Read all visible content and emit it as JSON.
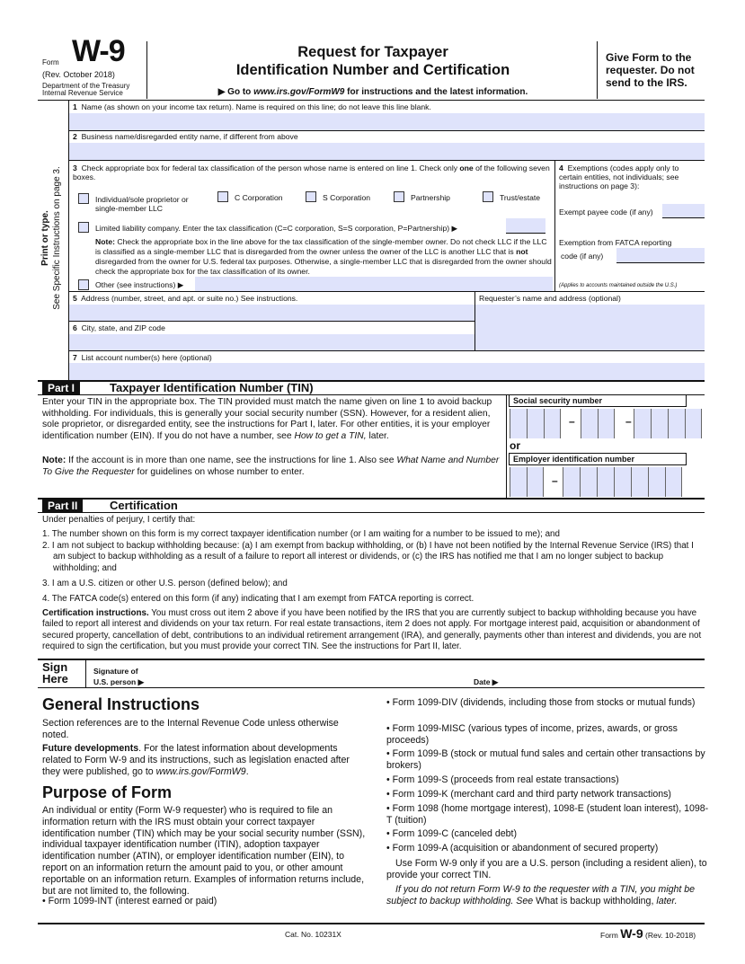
{
  "header": {
    "form_label": "Form",
    "form_number": "W-9",
    "revision": "(Rev. October 2018)",
    "department": "Department of the Treasury",
    "agency": "Internal Revenue Service",
    "title_line1": "Request for Taxpayer",
    "title_line2": "Identification Number and Certification",
    "goto_prefix": "▶ Go to ",
    "goto_url": "www.irs.gov/FormW9",
    "goto_suffix": " for instructions and the latest information.",
    "give_form": "Give Form to the requester. Do not send to the IRS."
  },
  "sidebar": {
    "line1": "Print or type.",
    "line2": "See Specific Instructions on page 3."
  },
  "fields": {
    "line1_num": "1",
    "line1_label": "Name (as shown on your income tax return). Name is required on this line; do not leave this line blank.",
    "line1_value": "",
    "line2_num": "2",
    "line2_label": "Business name/disregarded entity name, if different from above",
    "line2_value": "",
    "line3_num": "3",
    "line3_label_a": "Check appropriate box for federal tax classification of the person whose name is entered on line 1. Check only ",
    "line3_label_bold": "one",
    "line3_label_b": " of the following seven boxes.",
    "classifications": [
      {
        "label": "Individual/sole proprietor or single-member LLC",
        "checked": false
      },
      {
        "label": "C Corporation",
        "checked": false
      },
      {
        "label": "S Corporation",
        "checked": false
      },
      {
        "label": "Partnership",
        "checked": false
      },
      {
        "label": "Trust/estate",
        "checked": false
      }
    ],
    "llc_label": "Limited liability company. Enter the tax classification (C=C corporation, S=S corporation, P=Partnership) ▶",
    "llc_checked": false,
    "llc_value": "",
    "note_bold": "Note:",
    "note_a": " Check the appropriate box in the line above for the tax classification of the single-member owner.  Do not check LLC if the LLC is classified as a single-member LLC that is disregarded from the owner unless the owner of the LLC is another LLC that is ",
    "note_bold2": "not",
    "note_b": " disregarded from the owner for U.S. federal tax purposes. Otherwise, a single-member LLC that is disregarded from the owner should check the appropriate box for the tax classification of its owner.",
    "other_label": "Other (see instructions) ▶",
    "other_checked": false,
    "other_value": "",
    "line4_num": "4",
    "line4_label": "Exemptions (codes apply only to certain entities, not individuals; see instructions on page 3):",
    "exempt_payee_label": "Exempt payee code (if any)",
    "exempt_payee_value": "",
    "fatca_label_1": "Exemption from FATCA reporting",
    "fatca_label_2": "code (if any)",
    "fatca_value": "",
    "fatca_note": "(Applies to accounts maintained outside the U.S.)",
    "line5_num": "5",
    "line5_label": "Address (number, street, and apt. or suite no.) See instructions.",
    "line5_value": "",
    "requester_label": "Requester’s name and address (optional)",
    "requester_value": "",
    "line6_num": "6",
    "line6_label": "City, state, and ZIP code",
    "line6_value": "",
    "line7_num": "7",
    "line7_label": "List account number(s) here (optional)",
    "line7_value": ""
  },
  "part1": {
    "badge": "Part I",
    "title": "Taxpayer Identification Number (TIN)",
    "para1": "Enter your TIN in the appropriate box. The TIN provided must match the name given on line 1 to avoid backup withholding. For individuals, this is generally your social security number (SSN). However, for a resident alien, sole proprietor, or disregarded entity, see the instructions for Part I, later. For other entities, it is your employer identification number (EIN). If you do not have a number, see ",
    "para1_italic": "How to get a TIN,",
    "para1_end": " later.",
    "note_bold": "Note:",
    "note_a": " If the account is in more than one name, see the instructions for line 1. Also see ",
    "note_italic": "What Name and Number To Give the Requester",
    "note_b": " for guidelines on whose number to enter.",
    "ssn_label": "Social security number",
    "ssn_value": "",
    "or_label": "or",
    "ein_label": "Employer identification number",
    "ein_value": "",
    "dash": "–"
  },
  "part2": {
    "badge": "Part II",
    "title": "Certification",
    "intro": "Under penalties of perjury, I certify that:",
    "items": [
      "1. The number shown on this form is my correct taxpayer identification number (or I am waiting for a number to be issued to me); and",
      "2. I am not subject to backup withholding because: (a) I am exempt from backup withholding, or (b) I have not been notified by the Internal Revenue Service (IRS) that I am subject to backup withholding as a result of a failure to report all interest or dividends, or (c) the IRS has notified me that I am no longer subject to backup withholding; and",
      "3. I am a U.S. citizen or other U.S. person (defined below); and",
      "4. The FATCA code(s) entered on this form (if any) indicating that I am exempt from FATCA reporting is correct."
    ],
    "cert_instr_bold": "Certification instructions.",
    "cert_instr": " You must cross out item 2 above if you have been notified by the IRS that you are currently subject to backup withholding because you have failed to report all interest and dividends on your tax return. For real estate transactions, item 2 does not apply. For mortgage interest paid, acquisition or abandonment of secured property, cancellation of debt, contributions to an individual retirement arrangement (IRA), and generally, payments other than interest and dividends, you are not required to sign the certification, but you must provide your correct TIN. See the instructions for Part II, later."
  },
  "sign": {
    "sign_line1": "Sign",
    "sign_line2": "Here",
    "signature_label_1": "Signature of",
    "signature_label_2": "U.S. person ▶",
    "signature_value": "",
    "date_label": "Date ▶",
    "date_value": ""
  },
  "general": {
    "heading": "General Instructions",
    "section_refs": "Section references are to the Internal Revenue Code unless otherwise noted.",
    "future_bold": "Future developments",
    "future_text": ". For the latest information about developments related to Form W-9 and its instructions, such as legislation enacted after they were published, go to ",
    "future_url": "www.irs.gov/FormW9",
    "purpose_heading": "Purpose of Form",
    "purpose_text": "An individual or entity (Form W-9 requester) who is required to file an information return with the IRS must obtain your correct taxpayer identification number (TIN) which may be your social security number (SSN), individual taxpayer identification number (ITIN), adoption taxpayer identification number (ATIN), or employer identification number (EIN), to report on an information return the amount paid to you, or other amount reportable on an information return. Examples of information returns include, but are not limited to, the following.",
    "bullets_left": [
      "• Form 1099-INT (interest earned or paid)"
    ],
    "bullets_right": [
      "• Form 1099-DIV (dividends, including those from stocks or mutual funds)",
      "• Form 1099-MISC (various types of income, prizes, awards, or gross proceeds)",
      "• Form 1099-B (stock or mutual fund sales and certain other transactions by brokers)",
      "• Form 1099-S (proceeds from real estate transactions)",
      "• Form 1099-K (merchant card and third party network transactions)",
      "• Form 1098 (home mortgage interest), 1098-E (student loan interest), 1098-T (tuition)",
      "• Form 1099-C (canceled debt)",
      "• Form 1099-A (acquisition or abandonment of secured property)"
    ],
    "use_w9": "Use Form W-9 only if you are a U.S. person (including a resident alien), to provide your correct TIN.",
    "backup_italic": "If you do not return Form W-9 to the requester with a TIN, you might be subject to backup withholding. See ",
    "backup_normal": "What is backup withholding,",
    "backup_end": " later."
  },
  "footer": {
    "cat_no": "Cat. No. 10231X",
    "form_label": "Form",
    "form_number": "W-9",
    "revision": "(Rev. 10-2018)"
  }
}
